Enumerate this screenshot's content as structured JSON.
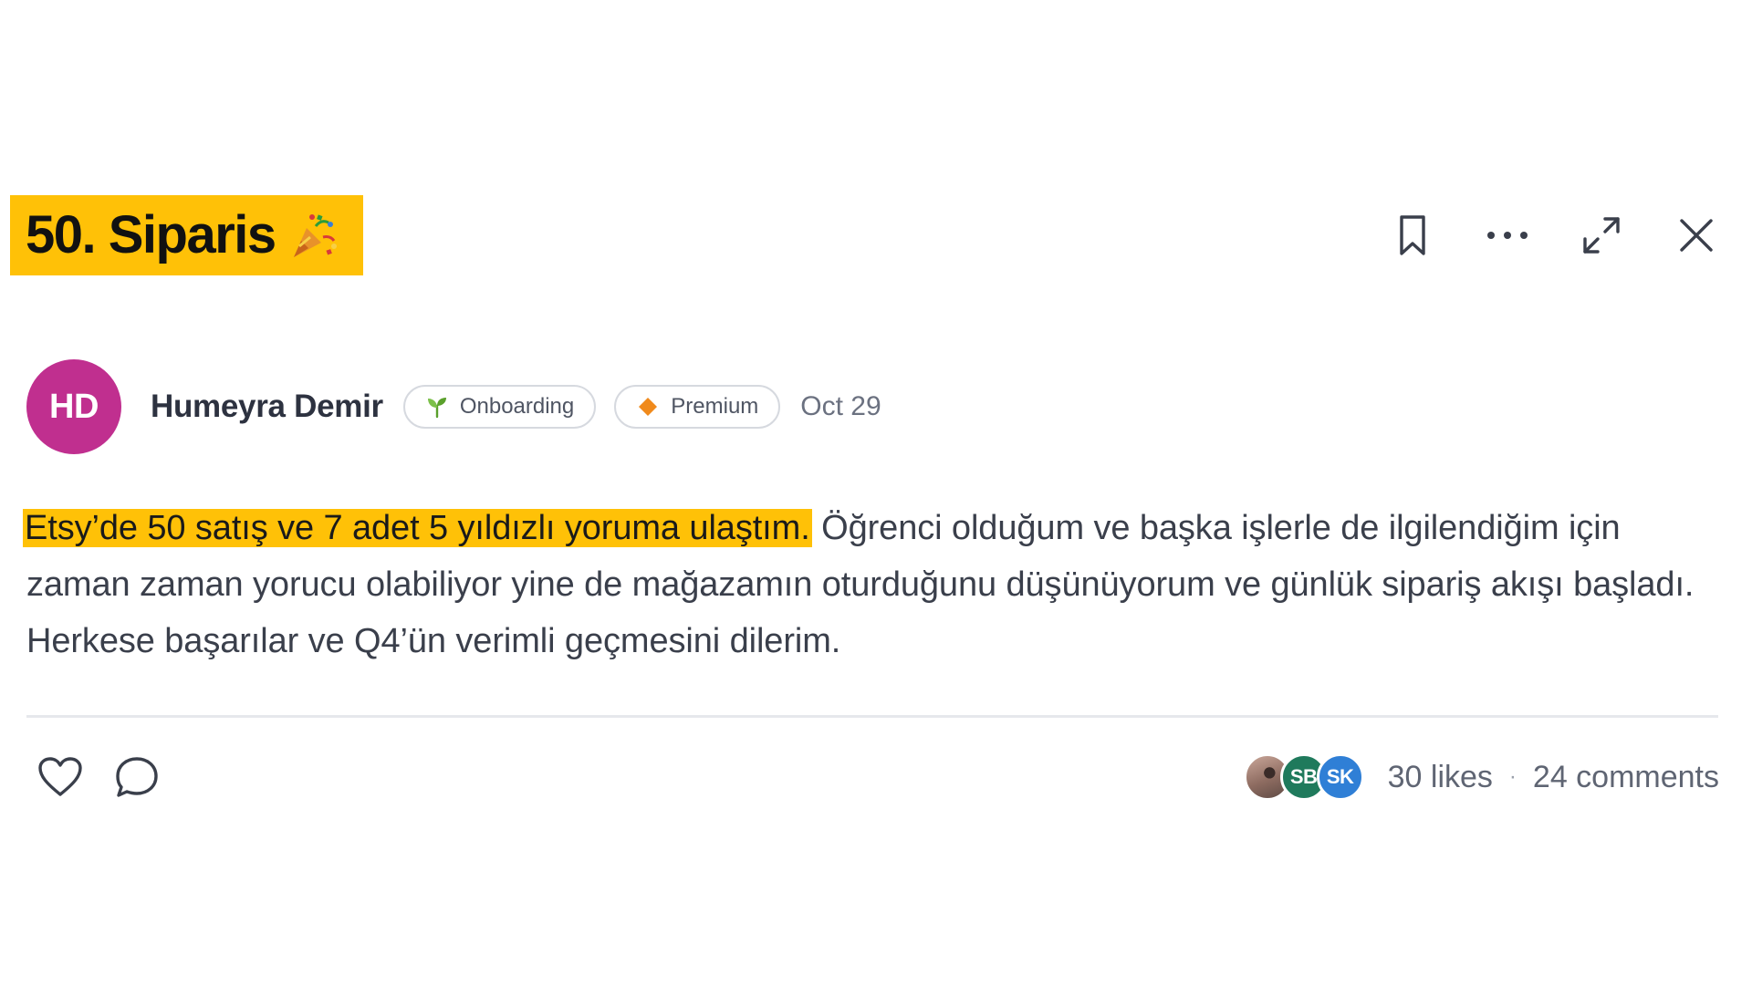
{
  "post": {
    "title": "50. Siparis",
    "title_emoji": "party-popper-icon",
    "highlight_color": "#ffc107",
    "author": {
      "initials": "HD",
      "name": "Humeyra Demir",
      "avatar_color": "#c02f8f"
    },
    "badges": [
      {
        "label": "Onboarding",
        "icon": "sprout-icon",
        "icon_color": "#5aa02c"
      },
      {
        "label": "Premium",
        "icon": "diamond-icon",
        "icon_color": "#f08a1c"
      }
    ],
    "date": "Oct 29",
    "body_highlight": "Etsy’de 50 satış ve 7 adet 5 yıldızlı yoruma ulaştım.",
    "body_rest": " Öğrenci olduğum ve başka işlerle de ilgilendiğim için zaman zaman yorucu olabiliyor yine de mağazamın oturduğunu düşünüyorum ve günlük sipariş akışı başladı. Herkese başarılar ve Q4’ün verimli geçmesini dilerim.",
    "reactors": [
      {
        "initials": "",
        "kind": "photo"
      },
      {
        "initials": "SB",
        "color": "#1f7a5c"
      },
      {
        "initials": "SK",
        "color": "#2f7fd6"
      }
    ],
    "likes_label": "30 likes",
    "separator": "·",
    "comments_label": "24 comments"
  },
  "actions": {
    "bookmark": "bookmark-icon",
    "more": "more-icon",
    "expand": "expand-icon",
    "close": "close-icon"
  }
}
